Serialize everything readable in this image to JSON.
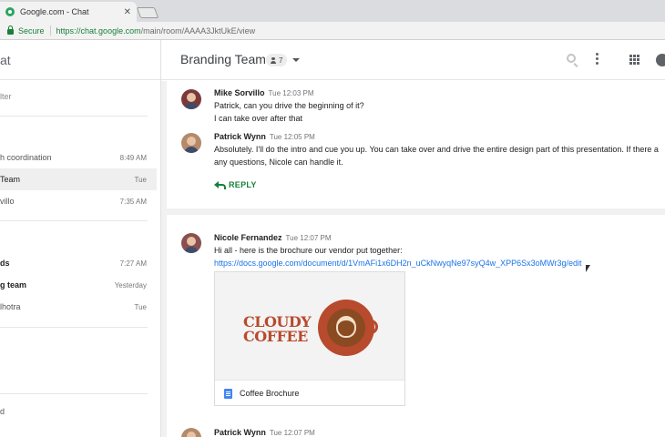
{
  "browser": {
    "tab_title": "Google.com - Chat",
    "tab_close": "✕",
    "secure_label": "Secure",
    "url_host": "https://chat.google.com",
    "url_path": "/main/room/AAAA3JktUkE/view"
  },
  "app": {
    "name_fragment": "at",
    "room_title": "Branding Team",
    "member_count": "7"
  },
  "sidebar": {
    "filter_placeholder": "lter",
    "items": [
      {
        "label": "h coordination",
        "time": "8:49 AM",
        "bold": false,
        "active": false
      },
      {
        "label": "Team",
        "time": "Tue",
        "bold": false,
        "active": true
      },
      {
        "label": "villo",
        "time": "7:35 AM",
        "bold": false,
        "active": false
      },
      {
        "label": "ds",
        "time": "7:27 AM",
        "bold": true,
        "active": false
      },
      {
        "label": "g team",
        "time": "Yesterday",
        "bold": true,
        "active": false
      },
      {
        "label": "lhotra",
        "time": "Tue",
        "bold": false,
        "active": false
      }
    ],
    "bottom_fragment": "d"
  },
  "thread1": {
    "messages": [
      {
        "author": "Mike Sorvillo",
        "time": "Tue 12:03 PM",
        "lines": [
          "Patrick, can you drive the beginning of it?",
          "I can take over after that"
        ]
      },
      {
        "author": "Patrick Wynn",
        "time": "Tue 12:05 PM",
        "lines": [
          "Absolutely. I'll do the intro and cue you up. You can take over and drive the entire design part of this presentation. If there a",
          "any questions, Nicole can handle it."
        ]
      }
    ],
    "reply_label": "REPLY"
  },
  "thread2": {
    "message": {
      "author": "Nicole Fernandez",
      "time": "Tue 12:07 PM",
      "text": "Hi all - here is the brochure our vendor put together:",
      "link": "https://docs.google.com/document/d/1VmAFi1x6DH2n_uCkNwyqNe97syQ4w_XPP6Sx3oMWr3g/edit"
    },
    "attachment": {
      "logo_line1": "CLOUDY",
      "logo_line2": "COFFEE",
      "title": "Coffee Brochure"
    },
    "next_author": "Patrick Wynn",
    "next_time": "Tue 12:07 PM"
  }
}
